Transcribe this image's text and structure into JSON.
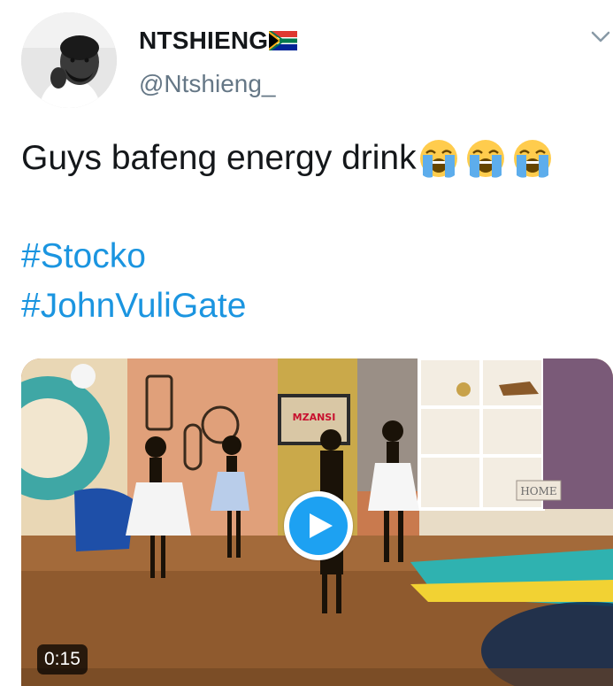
{
  "user": {
    "display_name": "NTSHIENG",
    "flag_icon": "south-africa-flag-icon",
    "handle": "@Ntshieng_"
  },
  "tweet": {
    "text": "Guys bafeng energy drink",
    "emojis": [
      "loudly-crying-face-icon",
      "loudly-crying-face-icon",
      "loudly-crying-face-icon"
    ],
    "hashtags": [
      "#Stocko",
      "#JohnVuliGate"
    ]
  },
  "media": {
    "type": "video",
    "duration": "0:15",
    "scene_sign": "MZANSI",
    "shelf_sign": "HOME"
  },
  "colors": {
    "text": "#14171a",
    "secondary": "#657786",
    "link": "#1b95e0",
    "play_button": "#1da1f2"
  }
}
